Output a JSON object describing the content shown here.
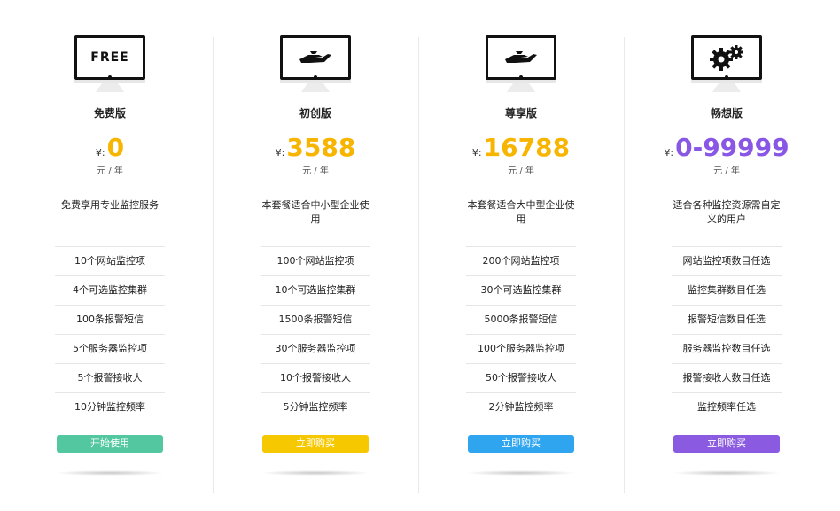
{
  "plans": [
    {
      "screen": "FREE",
      "screen_icon": "none",
      "name": "免费版",
      "currency": "¥:",
      "price": "0",
      "unit": "元 / 年",
      "description": "免费享用专业监控服务",
      "features": [
        "10个网站监控项",
        "4个可选监控集群",
        "100条报警短信",
        "5个服务器监控项",
        "5个报警接收人",
        "10分钟监控频率"
      ],
      "button": "开始使用",
      "price_color": "#f7b500",
      "button_color": "#52c7a0"
    },
    {
      "screen": "",
      "screen_icon": "hand-icon",
      "name": "初创版",
      "currency": "¥:",
      "price": "3588",
      "unit": "元 / 年",
      "description": "本套餐适合中小型企业使用",
      "features": [
        "100个网站监控项",
        "10个可选监控集群",
        "1500条报警短信",
        "30个服务器监控项",
        "10个报警接收人",
        "5分钟监控频率"
      ],
      "button": "立即购买",
      "price_color": "#f7b500",
      "button_color": "#f5c800"
    },
    {
      "screen": "",
      "screen_icon": "hand-icon",
      "name": "尊享版",
      "currency": "¥:",
      "price": "16788",
      "unit": "元 / 年",
      "description": "本套餐适合大中型企业使用",
      "features": [
        "200个网站监控项",
        "30个可选监控集群",
        "5000条报警短信",
        "100个服务器监控项",
        "50个报警接收人",
        "2分钟监控频率"
      ],
      "button": "立即购买",
      "price_color": "#f7b500",
      "button_color": "#30a5ef"
    },
    {
      "screen": "",
      "screen_icon": "gears-icon",
      "name": "畅想版",
      "currency": "¥:",
      "price": "0-99999",
      "unit": "元 / 年",
      "description": "适合各种监控资源需自定义的用户",
      "features": [
        "网站监控项数目任选",
        "监控集群数目任选",
        "报警短信数目任选",
        "服务器监控数目任选",
        "报警接收人数目任选",
        "监控频率任选"
      ],
      "button": "立即购买",
      "price_color": "#8957e5",
      "button_color": "#8a5ae0"
    }
  ]
}
